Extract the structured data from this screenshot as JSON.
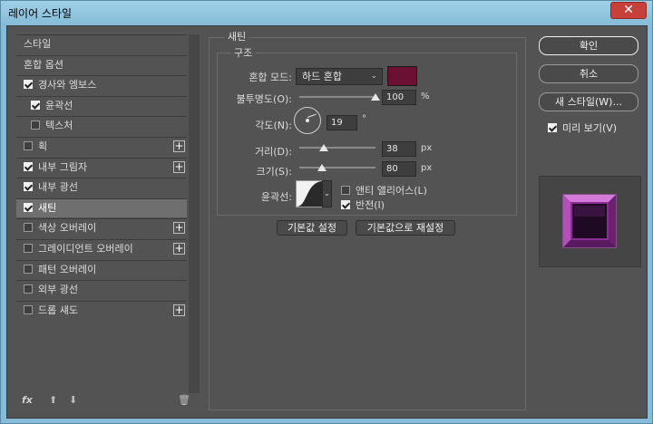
{
  "window": {
    "title": "레이어 스타일",
    "close": "✕"
  },
  "left_panel": {
    "items": [
      {
        "label": "스타일",
        "checkbox": false,
        "checked": false,
        "plus": false,
        "selected": false,
        "sub": false
      },
      {
        "label": "혼합 옵션",
        "checkbox": false,
        "checked": false,
        "plus": false,
        "selected": false,
        "sub": false
      },
      {
        "label": "경사와 엠보스",
        "checkbox": true,
        "checked": true,
        "plus": false,
        "selected": false,
        "sub": false
      },
      {
        "label": "윤곽선",
        "checkbox": true,
        "checked": true,
        "plus": false,
        "selected": false,
        "sub": true
      },
      {
        "label": "텍스처",
        "checkbox": true,
        "checked": false,
        "plus": false,
        "selected": false,
        "sub": true
      },
      {
        "label": "획",
        "checkbox": true,
        "checked": false,
        "plus": true,
        "selected": false,
        "sub": false
      },
      {
        "label": "내부 그림자",
        "checkbox": true,
        "checked": true,
        "plus": true,
        "selected": false,
        "sub": false
      },
      {
        "label": "내부 광선",
        "checkbox": true,
        "checked": true,
        "plus": false,
        "selected": false,
        "sub": false
      },
      {
        "label": "새틴",
        "checkbox": true,
        "checked": true,
        "plus": false,
        "selected": true,
        "sub": false
      },
      {
        "label": "색상 오버레이",
        "checkbox": true,
        "checked": false,
        "plus": true,
        "selected": false,
        "sub": false
      },
      {
        "label": "그레이디언트 오버레이",
        "checkbox": true,
        "checked": false,
        "plus": true,
        "selected": false,
        "sub": false
      },
      {
        "label": "패턴 오버레이",
        "checkbox": true,
        "checked": false,
        "plus": false,
        "selected": false,
        "sub": false
      },
      {
        "label": "외부 광선",
        "checkbox": true,
        "checked": false,
        "plus": false,
        "selected": false,
        "sub": false
      },
      {
        "label": "드롭 섀도",
        "checkbox": true,
        "checked": false,
        "plus": true,
        "selected": false,
        "sub": false
      }
    ],
    "bottom": {
      "fx": "fx",
      "up": "⬆",
      "down": "⬇",
      "trash": "🗑"
    }
  },
  "satin": {
    "group_title": "새틴",
    "structure_title": "구조",
    "blend_mode_label": "혼합 모드:",
    "blend_mode_value": "하드 혼합",
    "color": "#6b1032",
    "opacity_label": "불투명도(O):",
    "opacity_value": "100",
    "opacity_unit": "%",
    "opacity_fraction": 1.0,
    "angle_label": "각도(N):",
    "angle_value": "19",
    "angle_unit": "°",
    "distance_label": "거리(D):",
    "distance_value": "38",
    "distance_unit": "px",
    "distance_fraction": 0.32,
    "size_label": "크기(S):",
    "size_value": "80",
    "size_unit": "px",
    "size_fraction": 0.3,
    "contour_label": "윤곽선:",
    "antialias_label": "앤티 앨리어스(L)",
    "antialias_checked": false,
    "invert_label": "반전(I)",
    "invert_checked": true,
    "reset_default": "기본값 설정",
    "reset_to_default": "기본값으로 재설정"
  },
  "right_panel": {
    "ok": "확인",
    "cancel": "취소",
    "new_style": "새 스타일(W)...",
    "preview_label": "미리 보기(V)",
    "preview_checked": true
  }
}
